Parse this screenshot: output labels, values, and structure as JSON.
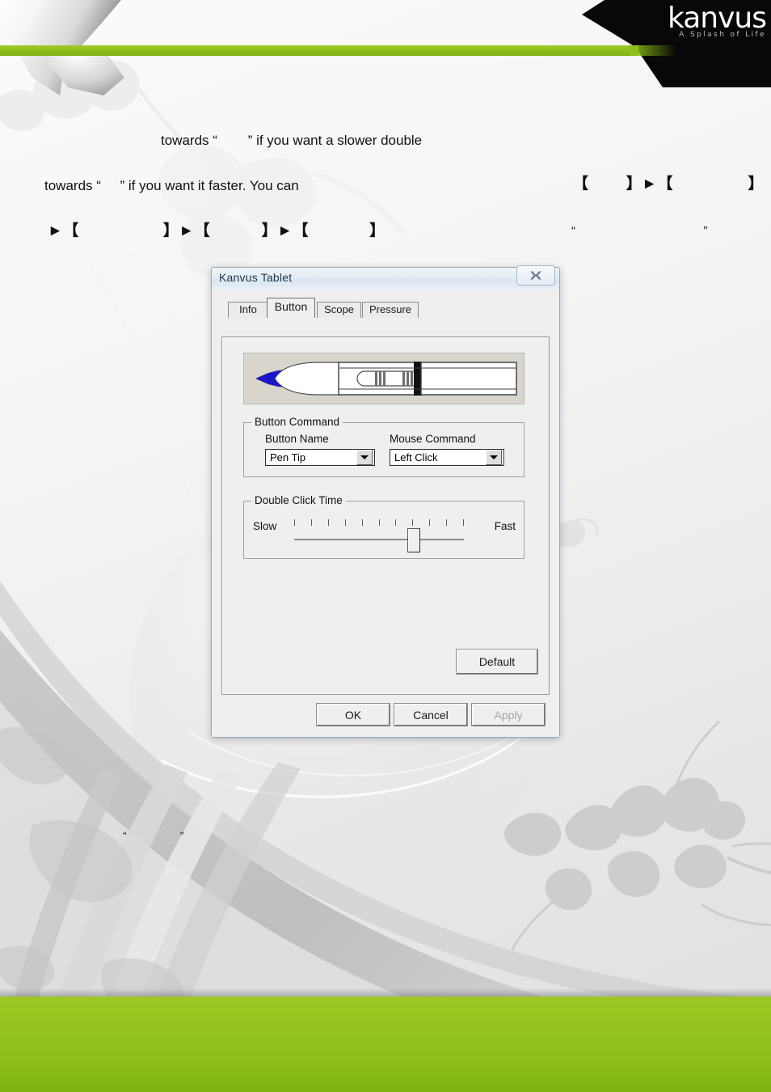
{
  "brand": {
    "wordmark": "kanvus",
    "tagline": "A Splash of Life"
  },
  "body_copy": {
    "line1": "towards “        ” if you want a slower double",
    "line2": "towards “     ” if you want it faster. You can",
    "line3": "►【                  】►【           】►【             】",
    "line3_right": "【        】►【                】",
    "line4": "“                                      ”",
    "line5": "“                 ”"
  },
  "dialog": {
    "title": "Kanvus Tablet",
    "close_label": "Close",
    "tabs": [
      {
        "label": "Info",
        "active": false
      },
      {
        "label": "Button",
        "active": true
      },
      {
        "label": "Scope",
        "active": false
      },
      {
        "label": "Pressure",
        "active": false
      }
    ],
    "pen_preview": {
      "tip_color": "#1a17c8",
      "body_color": "#ffffff",
      "plate_color": "#d8d5cd"
    },
    "button_command": {
      "legend": "Button Command",
      "button_name_label": "Button Name",
      "button_name_value": "Pen Tip",
      "mouse_command_label": "Mouse Command",
      "mouse_command_value": "Left Click"
    },
    "double_click_time": {
      "legend": "Double Click Time",
      "slow_label": "Slow",
      "fast_label": "Fast",
      "tick_count": 11,
      "value_index": 7
    },
    "buttons": {
      "default": "Default",
      "ok": "OK",
      "cancel": "Cancel",
      "apply": "Apply",
      "apply_disabled": true
    }
  },
  "colors": {
    "accent_green": "#8cbf18",
    "header_black": "#080808",
    "title_text": "#25374b",
    "pen_tip_blue": "#1a17c8"
  }
}
